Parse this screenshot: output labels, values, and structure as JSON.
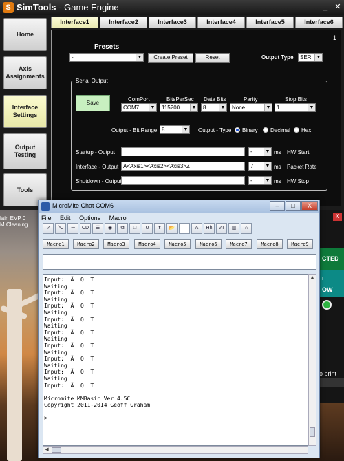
{
  "simtools": {
    "title_brand": "SimTools",
    "title_rest": " - Game Engine",
    "window_buttons": {
      "minimize": "_",
      "close": "✕"
    },
    "nav": [
      {
        "label": "Home"
      },
      {
        "label": "Axis Assignments"
      },
      {
        "label": "Interface Settings",
        "active": true
      },
      {
        "label": "Output Testing"
      },
      {
        "label": "Tools"
      }
    ],
    "tabs": [
      "Interface1",
      "Interface2",
      "Interface3",
      "Interface4",
      "Interface5",
      "Interface6"
    ],
    "active_tab": "Interface1",
    "panel_number": "1",
    "presets": {
      "label": "Presets",
      "value": "-",
      "create_button": "Create Preset",
      "reset_button": "Reset"
    },
    "output_type": {
      "label": "Output Type",
      "value": "SER"
    },
    "serial": {
      "group_title": "Serial Output",
      "save_button": "Save",
      "comport": {
        "label": "ComPort",
        "value": "COM7"
      },
      "bitspersec": {
        "label": "BitsPerSec",
        "value": "115200"
      },
      "databits": {
        "label": "Data Bits",
        "value": "8"
      },
      "parity": {
        "label": "Parity",
        "value": "None"
      },
      "stopbits": {
        "label": "Stop Bits",
        "value": "1"
      },
      "bit_range": {
        "label": "Output - Bit Range",
        "value": "8"
      },
      "output_type_label": "Output - Type",
      "radio": {
        "binary": "Binary",
        "decimal": "Decimal",
        "hex": "Hex",
        "selected": "binary"
      },
      "startup": {
        "label": "Startup - Output",
        "value": "",
        "ms_value": "-",
        "ms_label": "ms",
        "hint": "HW Start"
      },
      "interface": {
        "label": "Interface - Output",
        "value": "A<Axis1><Axis2><Axis3>Z",
        "ms_value": "7",
        "ms_label": "ms",
        "hint": "Packet Rate"
      },
      "shutdown": {
        "label": "Shutdown - Output",
        "value": "",
        "ms_value": "-",
        "ms_label": "ms",
        "hint": "HW Stop"
      }
    }
  },
  "desktop": {
    "text1": "lain  EVP 0",
    "text2": "M  Cleaning"
  },
  "right_app": {
    "close": "X",
    "green_text": "CTED",
    "teal_text": "r",
    "teal2_text": "OW",
    "print_text": "o print"
  },
  "micromite": {
    "title": "MicroMite Chat  COM6",
    "window_buttons": {
      "minimize": "–",
      "maximize": "□",
      "close": "X"
    },
    "menu": [
      "File",
      "Edit",
      "Options",
      "Macro"
    ],
    "toolbar": [
      "?",
      "^C",
      "⇒",
      "CD",
      "☰",
      "◉",
      "⧉",
      "□",
      "U",
      "⬍",
      "📂",
      "",
      "A",
      "Hh",
      "VT",
      "▥",
      "∩"
    ],
    "macros": [
      "Macro1",
      "Macro2",
      "Macro3",
      "Macro4",
      "Macro5",
      "Macro6",
      "Macro7",
      "Macro8",
      "Macro9"
    ],
    "console": "Input:  Ã  Q  T\nWaiting\nInput:  Ã  Q  T\nWaiting\nInput:  Ã  Q  T\nWaiting\nInput:  Ã  Q  T\nWaiting\nInput:  Ã  Q  T\nWaiting\nInput:  Ã  Q  T\nWaiting\nInput:  Ã  Q  T\nWaiting\nInput:  Ã  Q  T\nWaiting\nInput:  Ã  Q  T\n\nMicromite MMBasic Ver 4.5C\nCopyright 2011-2014 Geoff Graham\n\n>"
  }
}
